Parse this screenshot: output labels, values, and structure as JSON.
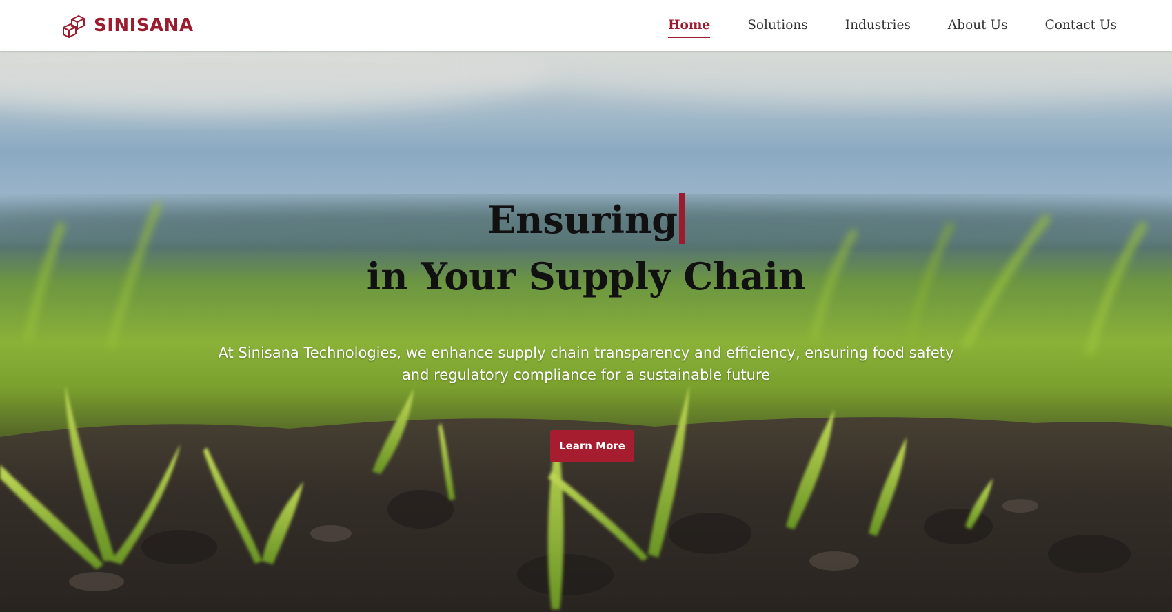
{
  "brand": {
    "name": "SINISANA",
    "color": "#9b1c2e"
  },
  "nav": {
    "items": [
      {
        "label": "Home",
        "active": true
      },
      {
        "label": "Solutions",
        "active": false
      },
      {
        "label": "Industries",
        "active": false
      },
      {
        "label": "About Us",
        "active": false
      },
      {
        "label": "Contact Us",
        "active": false
      }
    ]
  },
  "hero": {
    "headline_line1": "Ensuring",
    "headline_line2": "in Your Supply Chain",
    "subtitle": "At Sinisana Technologies, we enhance supply chain transparency and efficiency, ensuring food safety and regulatory compliance for a sustainable future",
    "cta_label": "Learn More",
    "background": "crop-seedlings-in-soil-photo"
  },
  "colors": {
    "accent": "#9b1c2e",
    "button": "#a51d2e",
    "headline": "#111111",
    "subtitle": "#ffffff"
  }
}
